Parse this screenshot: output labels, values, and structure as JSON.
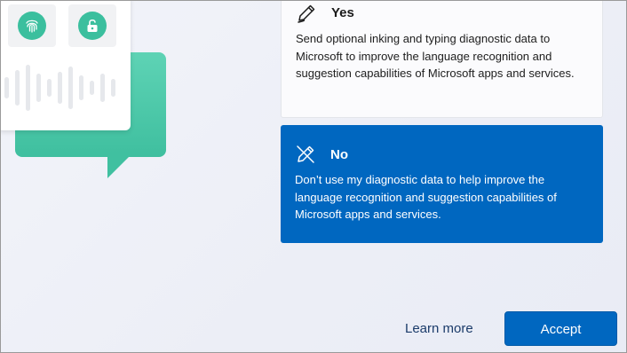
{
  "options": {
    "yes": {
      "title": "Yes",
      "icon": "pen-icon",
      "description": "Send optional inking and typing diagnostic data to Microsoft to improve the language recognition and suggestion capabilities of Microsoft apps and services.",
      "selected": false
    },
    "no": {
      "title": "No",
      "icon": "pen-off-icon",
      "description": "Don’t use my diagnostic data to help improve the language recognition and suggestion capabilities of Microsoft apps and services.",
      "selected": true
    }
  },
  "footer": {
    "learn_more_label": "Learn more",
    "accept_label": "Accept"
  },
  "illustration": {
    "tiles": [
      "fingerprint-icon",
      "unlock-icon"
    ]
  },
  "colors": {
    "accent": "#0067c0",
    "teal": "#3fbf9f",
    "background": "#eef0f7"
  }
}
